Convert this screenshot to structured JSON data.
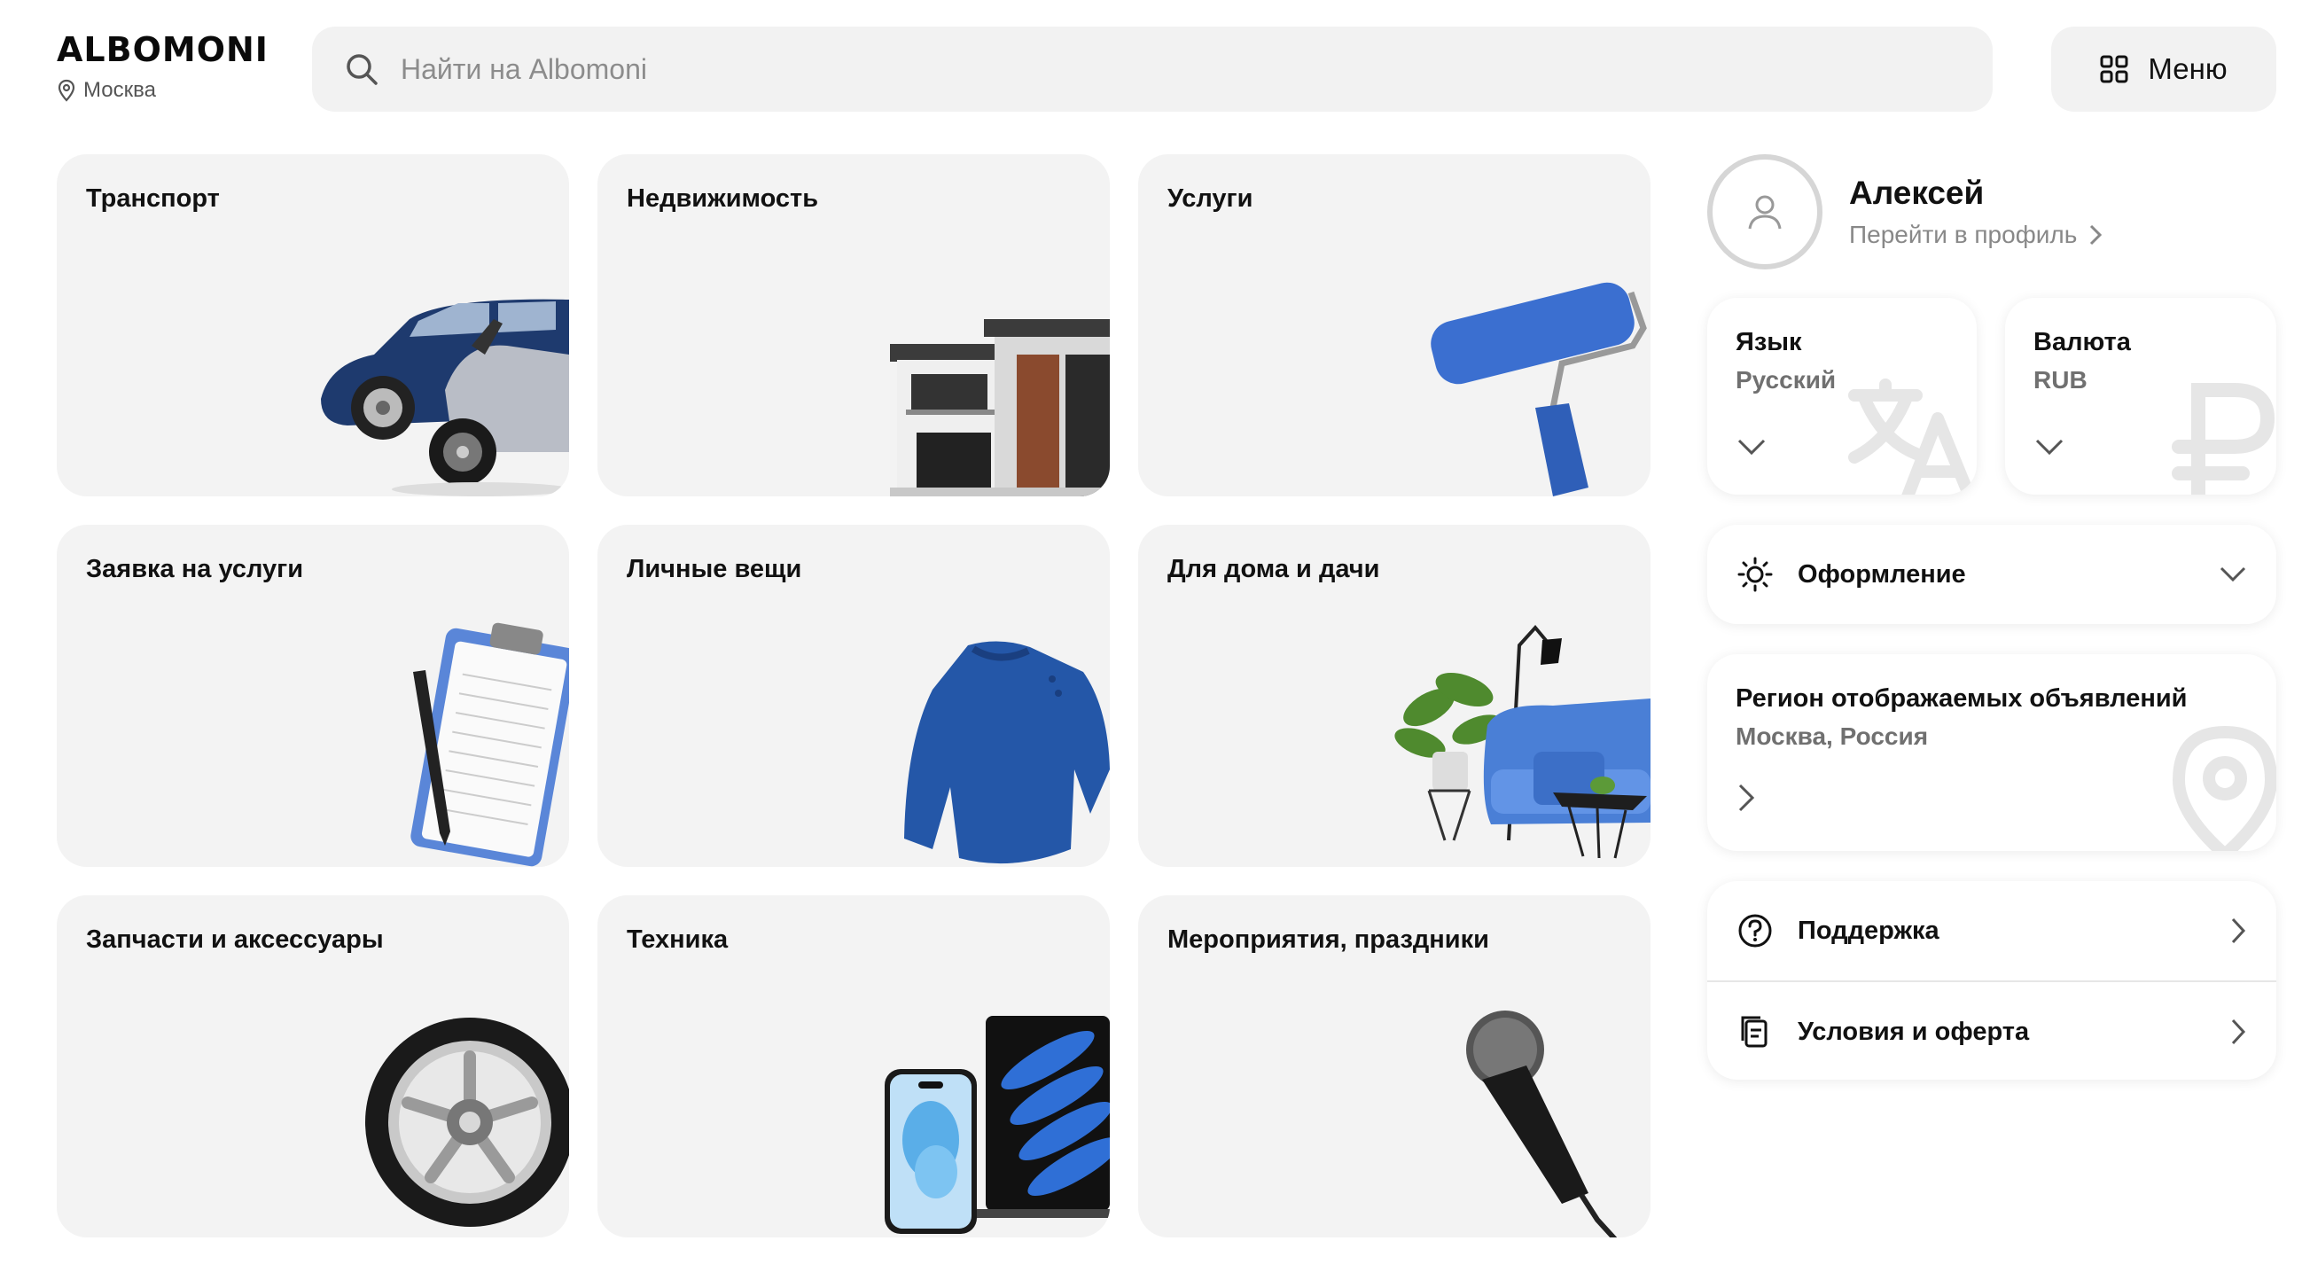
{
  "header": {
    "logo": "ALBOMONI",
    "city": "Москва",
    "search_placeholder": "Найти на Albomoni",
    "menu_label": "Меню"
  },
  "categories": [
    {
      "title": "Транспорт",
      "icon": "car-motorcycle"
    },
    {
      "title": "Недвижимость",
      "icon": "house"
    },
    {
      "title": "Услуги",
      "icon": "paint-roller"
    },
    {
      "title": "Заявка на услуги",
      "icon": "clipboard-pen"
    },
    {
      "title": "Личные вещи",
      "icon": "sweater"
    },
    {
      "title": "Для дома и дачи",
      "icon": "sofa-plant"
    },
    {
      "title": "Запчасти и аксессуары",
      "icon": "wheel"
    },
    {
      "title": "Техника",
      "icon": "phone-laptop"
    },
    {
      "title": "Мероприятия, праздники",
      "icon": "microphone"
    }
  ],
  "profile": {
    "name": "Алексей",
    "link": "Перейти в профиль"
  },
  "language": {
    "label": "Язык",
    "value": "Русский",
    "icon": "translate-icon"
  },
  "currency": {
    "label": "Валюта",
    "value": "RUB",
    "icon": "ruble-icon"
  },
  "theme": {
    "label": "Оформление",
    "icon": "sun-icon"
  },
  "region": {
    "label": "Регион отображаемых объявлений",
    "value": "Москва, Россия",
    "icon": "map-pin-icon"
  },
  "links": [
    {
      "label": "Поддержка",
      "icon": "question-icon"
    },
    {
      "label": "Условия и оферта",
      "icon": "document-icon"
    }
  ],
  "colors": {
    "accent_blue": "#2f65c8",
    "card_bg": "#f3f3f3",
    "muted_text": "#888888"
  }
}
